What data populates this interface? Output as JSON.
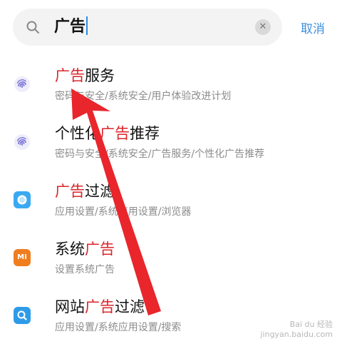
{
  "search": {
    "query": "广告",
    "cancel_label": "取消",
    "clear_symbol": "✕"
  },
  "results": [
    {
      "title_pre": "",
      "title_hl": "广告",
      "title_post": "服务",
      "path": "密码与安全/系统安全/用户体验改进计划",
      "icon": "fingerprint-icon"
    },
    {
      "title_pre": "个性化",
      "title_hl": "广告",
      "title_post": "推荐",
      "path": "密码与安全/系统安全/广告服务/个性化广告推荐",
      "icon": "fingerprint-icon"
    },
    {
      "title_pre": "",
      "title_hl": "广告",
      "title_post": "过滤",
      "path": "应用设置/系统应用设置/浏览器",
      "icon": "browser-icon"
    },
    {
      "title_pre": "系统",
      "title_hl": "广告",
      "title_post": "",
      "path": "设置系统广告",
      "icon": "mi-icon",
      "icon_text": "MI"
    },
    {
      "title_pre": "网站",
      "title_hl": "广告",
      "title_post": "过滤",
      "path": "应用设置/系统应用设置/搜索",
      "icon": "search-app-icon"
    }
  ],
  "colors": {
    "highlight": "#d9262c",
    "accent": "#3c8fde",
    "arrow": "#e8262c"
  },
  "watermark": {
    "line1": "Bai du 经验",
    "line2": "jingyan.baidu.com"
  }
}
